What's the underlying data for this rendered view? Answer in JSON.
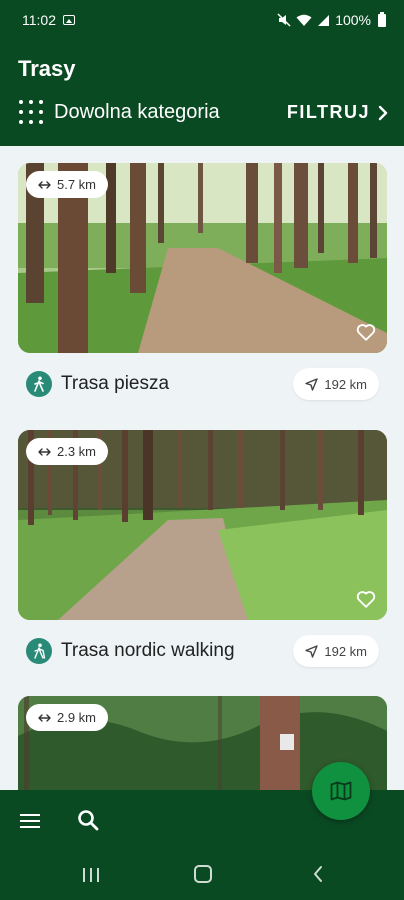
{
  "status_bar": {
    "time": "11:02",
    "battery": "100%"
  },
  "app_bar": {
    "title": "Trasy",
    "category_label": "Dowolna kategoria",
    "filter_label": "FILTRUJ",
    "filter_arrow": "›"
  },
  "routes": [
    {
      "name": "Trasa piesza",
      "length": "5.7 km",
      "distance": "192 km",
      "type_icon": "walking-icon",
      "favorite": false
    },
    {
      "name": "Trasa nordic walking",
      "length": "2.3 km",
      "distance": "192 km",
      "type_icon": "nordic-walking-icon",
      "favorite": false
    },
    {
      "name": "",
      "length": "2.9 km",
      "distance": "",
      "type_icon": "",
      "favorite": false
    }
  ],
  "icons": {
    "menu": "menu-icon",
    "search": "search-icon",
    "map": "map-icon",
    "categories": "grid-icon"
  },
  "colors": {
    "primary": "#0a4a23",
    "fab": "#10913f",
    "route_type": "#2a8a78",
    "background": "#eef3f6"
  }
}
